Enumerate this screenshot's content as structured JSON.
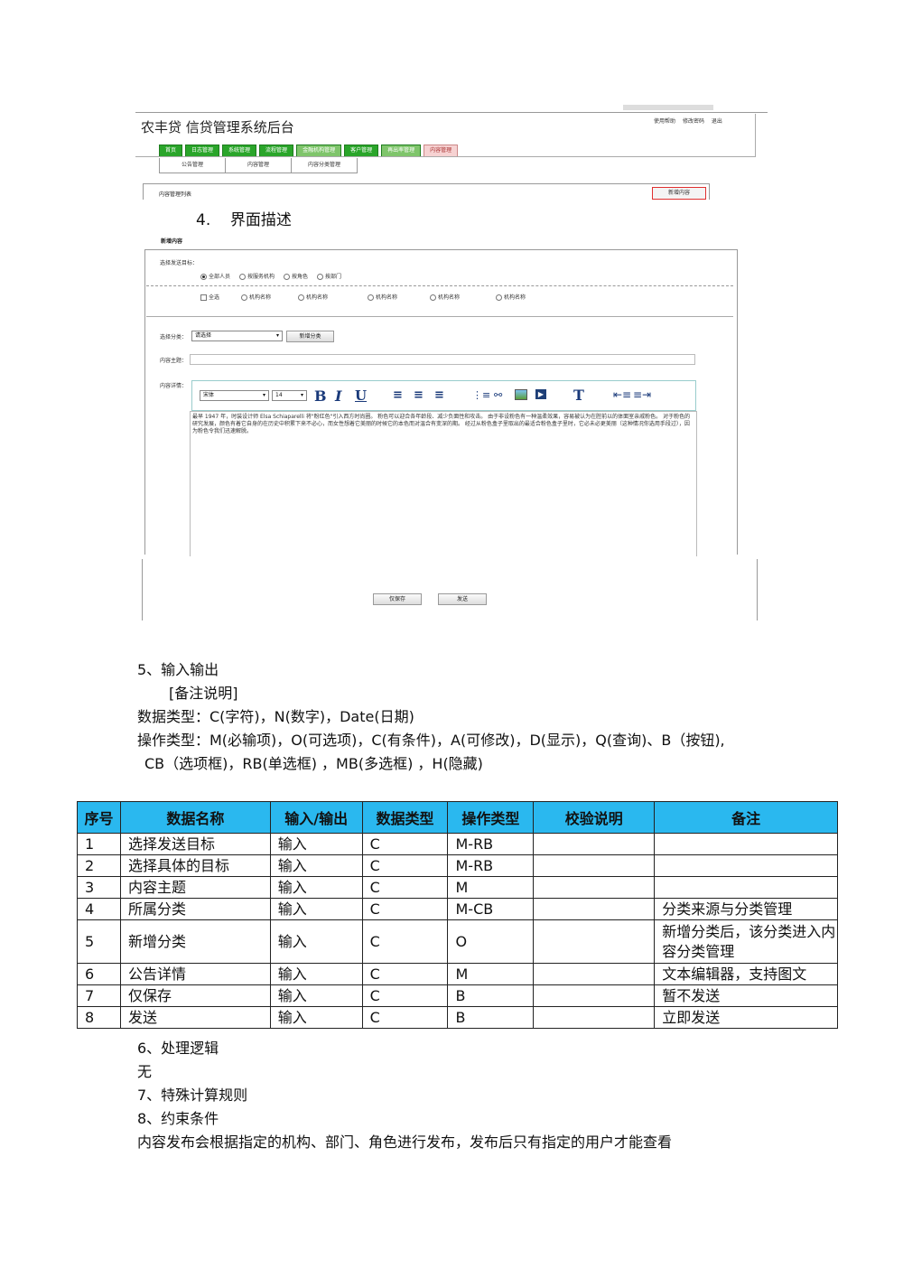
{
  "app": {
    "title": "农丰贷 信贷管理系统后台",
    "header_links": [
      "使用帮助",
      "修改密码",
      "退出"
    ],
    "nav_tabs": [
      "首页",
      "日志管理",
      "系统管理",
      "流程管理",
      "金融机构管理",
      "客户管理",
      "再出率管理",
      "内容管理"
    ],
    "sub_nav": [
      "公告管理",
      "内容管理",
      "内容分类管理"
    ],
    "list_title": "内容管理列表",
    "add_content_button": "新增内容"
  },
  "section4": {
    "heading": "4.    界面描述"
  },
  "form": {
    "title": "新增内容",
    "target_label": "选择发送目标：",
    "target_options": [
      "全部人员",
      "按服务机构",
      "按角色",
      "按部门"
    ],
    "specific_options": [
      "全选",
      "机构名称",
      "机构名称",
      "机构名称",
      "机构名称",
      "机构名称"
    ],
    "category_label": "选择分类：",
    "category_select": "请选择",
    "add_category_button": "新增分类",
    "subject_label": "内容主题：",
    "detail_label": "内容详情：",
    "font_select": "宋体",
    "size_select": "14",
    "editor_text": "最早 1947 年，时装设计师 Elsa Schiaparelli 将\"粉红色\"引入西方时尚圈。 粉色可以迎合各年龄段、减少负面性和攻击。 由于非设粉色有一种温柔效果，容易被认为在腔前以的体面室亲戚粉色。 对于粉色的研究发展，颜色有着它自身的在历史中积累下来不必心，而女性想着它美丽的时候它的本色而对温合有变深的期。 经过从粉色盒子里取出的最适合粉色盒子里时，它必未必更美丽（这种情况你选用手段过），因为粉色令我们迅速解脱。",
    "save_only_button": "仅保存",
    "send_button": "发送"
  },
  "section5": {
    "heading": "5、输入输出",
    "note_title": "[备注说明]",
    "data_types": "数据类型：C(字符)，N(数字)，Date(日期)",
    "op_types_line1": "操作类型：M(必输项)，O(可选项)，C(有条件)，A(可修改)，D(显示)，Q(查询)、B（按钮),",
    "op_types_line2": "CB（选项框)，RB(单选框) ，MB(多选框) ，H(隐藏)"
  },
  "table": {
    "headers": [
      "序号",
      "数据名称",
      "输入/输出",
      "数据类型",
      "操作类型",
      "校验说明",
      "备注"
    ],
    "rows": [
      [
        "1",
        "选择发送目标",
        "输入",
        "C",
        "M-RB",
        "",
        ""
      ],
      [
        "2",
        "选择具体的目标",
        "输入",
        "C",
        "M-RB",
        "",
        ""
      ],
      [
        "3",
        "内容主题",
        "输入",
        "C",
        "M",
        "",
        ""
      ],
      [
        "4",
        "所属分类",
        "输入",
        "C",
        "M-CB",
        "",
        "分类来源与分类管理"
      ],
      [
        "5",
        "新增分类",
        "输入",
        "C",
        "O",
        "",
        "新增分类后，该分类进入内容分类管理"
      ],
      [
        "6",
        "公告详情",
        "输入",
        "C",
        "M",
        "",
        "文本编辑器，支持图文"
      ],
      [
        "7",
        "仅保存",
        "输入",
        "C",
        "B",
        "",
        "暂不发送"
      ],
      [
        "8",
        "发送",
        "输入",
        "C",
        "B",
        "",
        "立即发送"
      ]
    ]
  },
  "section6": {
    "heading": "6、处理逻辑",
    "body": "无"
  },
  "section7": {
    "heading": "7、特殊计算规则"
  },
  "section8": {
    "heading": "8、约束条件",
    "body": "内容发布会根据指定的机构、部门、角色进行发布，发布后只有指定的用户才能查看"
  }
}
